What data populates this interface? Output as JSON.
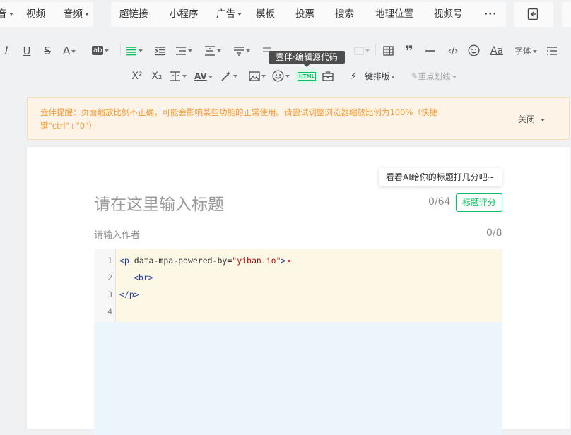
{
  "topbar": {
    "left_fragment": "音",
    "video": "视频",
    "audio": "音频",
    "hyperlink": "超链接",
    "miniprogram": "小程序",
    "ad": "广告",
    "template": "模板",
    "vote": "投票",
    "search": "搜索",
    "location": "地理位置",
    "channels": "视频号",
    "more": "···"
  },
  "toolbar": {
    "font_label": "字体",
    "fontcolor_letter": "A",
    "bgcolor_letter": "ab",
    "onekey_layout": "一键排版",
    "highlight": "重点划线",
    "superscript": "X²",
    "subscript": "X₂",
    "html_badge": "HTML"
  },
  "tooltip": "壹伴·编辑源代码",
  "warning": {
    "text": "壹伴提醒：页面缩放比例不正确，可能会影响某些功能的正常使用。请尝试调整浏览器缩放比例为100%（快捷键\"ctrl\"+\"0\"）",
    "close": "关闭"
  },
  "editor": {
    "ai_hint": "看看AI给你的标题打几分吧~",
    "title_placeholder": "请在这里输入标题",
    "title_count": "0/64",
    "title_score": "标题评分",
    "author_placeholder": "请输入作者",
    "author_count": "0/8"
  },
  "code": {
    "line_numbers": [
      "1",
      "2",
      "3",
      "4"
    ],
    "line1_tag_open": "<p",
    "line1_attr": " data-mpa-powered-by=",
    "line1_value": "\"yiban.io\"",
    "line1_tag_close": ">",
    "line2": "<br>",
    "line3": "</p>"
  },
  "colors": {
    "accent_green": "#07c160",
    "warning_text": "#f29c38",
    "code_bg": "#fdf8e5",
    "blank_bg": "#edf5fc"
  }
}
